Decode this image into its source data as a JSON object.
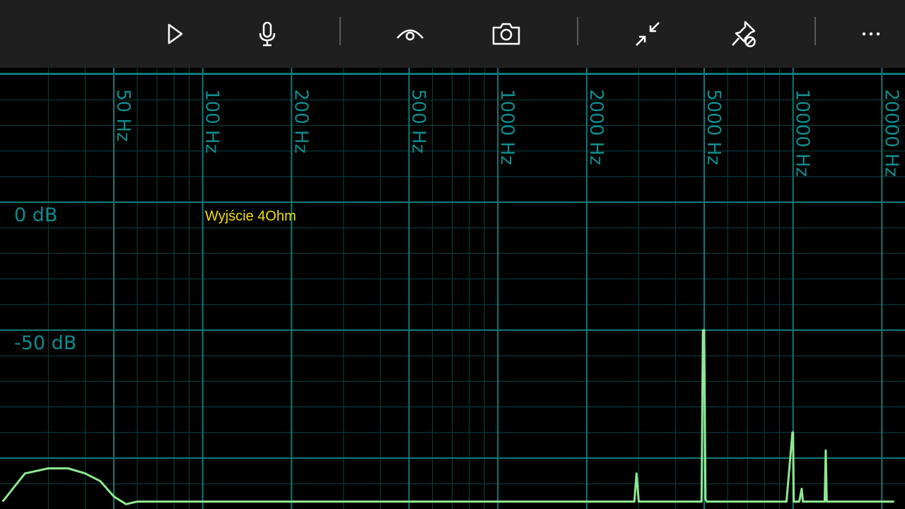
{
  "toolbar": {
    "buttons": [
      {
        "name": "play-button",
        "icon": "play-icon"
      },
      {
        "name": "microphone-button",
        "icon": "microphone-icon"
      },
      {
        "name": "view-button",
        "icon": "eye-icon"
      },
      {
        "name": "screenshot-button",
        "icon": "camera-icon"
      },
      {
        "name": "compact-view-button",
        "icon": "collapse-arrows-icon"
      },
      {
        "name": "unpin-button",
        "icon": "unpin-icon"
      },
      {
        "name": "more-options-button",
        "icon": "more-icon"
      }
    ]
  },
  "colors": {
    "toolbar_bg": "#1f1f1f",
    "icon": "#ffffff",
    "grid_major": "#0e7a7a",
    "grid_minor": "#0a4444",
    "label": "#0f8c8c",
    "trace": "#90e890",
    "annotation": "#f0e000"
  },
  "chart_data": {
    "type": "line",
    "x_scale": "log",
    "x_ticks": [
      50,
      100,
      200,
      500,
      1000,
      2000,
      5000,
      10000,
      20000
    ],
    "x_tick_labels": [
      "50 Hz",
      "100 Hz",
      "200 Hz",
      "500 Hz",
      "1000 Hz",
      "2000 Hz",
      "5000 Hz",
      "10000 Hz",
      "20000 Hz"
    ],
    "y_ticks": [
      0,
      -50
    ],
    "y_tick_labels": [
      "0 dB",
      "-50 dB"
    ],
    "xlim": [
      21,
      22000
    ],
    "ylim": [
      -120,
      50
    ],
    "annotation": "Wyjście 4Ohm",
    "grid": true,
    "series": [
      {
        "x": [
          21,
          25,
          30,
          35,
          40,
          45,
          50,
          55,
          60,
          70,
          80,
          100,
          200,
          500,
          1000,
          2000,
          2900,
          2950,
          3000,
          3100,
          4000,
          4900,
          4950,
          5000,
          5050,
          5100,
          5500,
          7000,
          9500,
          9950,
          10000,
          10050,
          10200,
          10500,
          10700,
          10800,
          11000,
          12000,
          12800,
          12900,
          13000,
          15000,
          20000,
          22000
        ],
        "y": [
          -117,
          -106,
          -104,
          -104,
          -106,
          -109,
          -115,
          -118,
          -117,
          -117,
          -117,
          -117,
          -117,
          -117,
          -117,
          -117,
          -117,
          -106,
          -117,
          -117,
          -117,
          -117,
          -50,
          -50,
          -116,
          -117,
          -117,
          -117,
          -117,
          -90,
          -90,
          -117,
          -117,
          -117,
          -112,
          -117,
          -117,
          -117,
          -117,
          -97,
          -117,
          -117,
          -117,
          -117
        ]
      }
    ]
  }
}
